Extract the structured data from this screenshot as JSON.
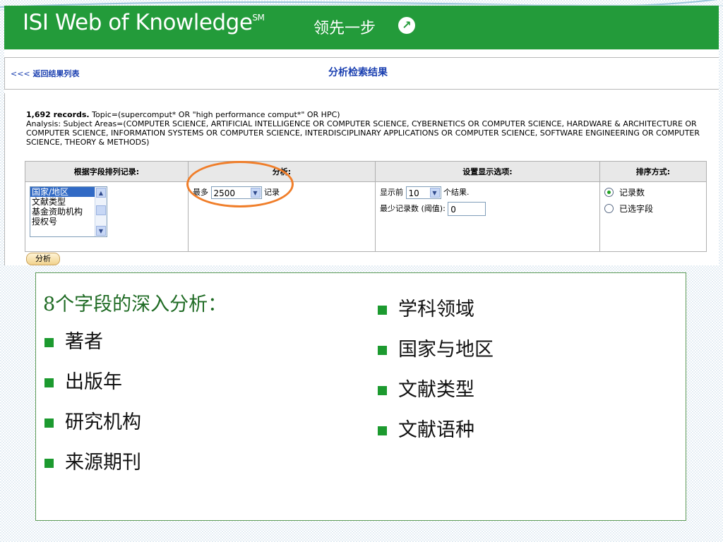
{
  "banner": {
    "product": "ISI Web of Knowledge",
    "trademark": "SM",
    "slogan": "领先一步",
    "arrow_glyph": "↗"
  },
  "nav": {
    "back_chevrons": "<<<",
    "back_label": "返回结果列表",
    "page_title": "分析检索结果"
  },
  "summary": {
    "count": "1,692 records.",
    "topic": "Topic=(supercomput* OR \"high performance comput*\" OR HPC)",
    "analysis": "Analysis:  Subject Areas=(COMPUTER SCIENCE, ARTIFICIAL INTELLIGENCE OR COMPUTER SCIENCE, CYBERNETICS OR COMPUTER SCIENCE, HARDWARE & ARCHITECTURE OR COMPUTER SCIENCE, INFORMATION SYSTEMS OR COMPUTER SCIENCE, INTERDISCIPLINARY APPLICATIONS OR COMPUTER SCIENCE, SOFTWARE ENGINEERING OR COMPUTER SCIENCE, THEORY & METHODS)"
  },
  "table": {
    "headers": [
      "根据字段排列记录:",
      "分析:",
      "设置显示选项:",
      "排序方式:"
    ],
    "field_options": [
      "国家/地区",
      "文献类型",
      "基金资助机构",
      "授权号"
    ],
    "analysis_prefix": "最多",
    "analysis_value": "2500",
    "analysis_suffix": "记录",
    "display_prefix": "显示前",
    "display_value": "10",
    "display_suffix": "个结果.",
    "threshold_label": "最少记录数  (阈值):",
    "threshold_value": "0",
    "sort_options": [
      "记录数",
      "已选字段"
    ]
  },
  "analyze_button": "分析",
  "colors": {
    "banner_green": "#239b3a",
    "link_blue": "#1a3fb0",
    "highlight_orange": "#f07e2a",
    "bullet_green": "#1c9a2f"
  },
  "fields_panel": {
    "heading": "8个字段的深入分析：",
    "left_items": [
      "著者",
      "出版年",
      "研究机构",
      "来源期刊"
    ],
    "right_items": [
      "学科领域",
      "国家与地区",
      "文献类型",
      "文献语种"
    ]
  }
}
